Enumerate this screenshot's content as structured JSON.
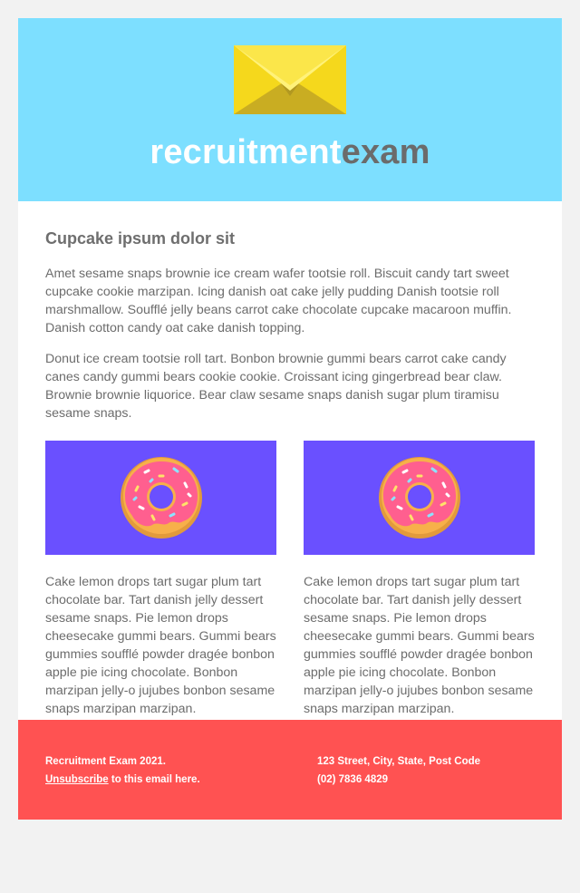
{
  "header": {
    "logo_part1": "recruitment",
    "logo_part2": "exam",
    "icon": "envelope-icon"
  },
  "content": {
    "title": "Cupcake ipsum dolor sit",
    "paragraph1": "Amet sesame snaps brownie ice cream wafer tootsie roll. Biscuit candy tart sweet cupcake cookie marzipan. Icing danish oat cake jelly pudding Danish tootsie roll marshmallow. Soufflé jelly beans carrot cake chocolate cupcake macaroon muffin. Danish cotton candy oat cake danish topping.",
    "paragraph2": "Donut ice cream tootsie roll tart. Bonbon brownie gummi bears carrot cake candy canes candy gummi bears cookie cookie. Croissant icing gingerbread bear claw. Brownie brownie liquorice. Bear claw sesame snaps danish sugar plum tiramisu sesame snaps.",
    "columns": [
      {
        "icon": "donut-icon",
        "text": "Cake lemon drops tart sugar plum tart chocolate bar. Tart danish jelly dessert sesame snaps. Pie lemon drops cheesecake gummi bears. Gummi bears gummies soufflé powder dragée bonbon apple pie icing chocolate. Bonbon marzipan jelly-o jujubes bonbon sesame snaps marzipan marzipan."
      },
      {
        "icon": "donut-icon",
        "text": "Cake lemon drops tart sugar plum tart chocolate bar. Tart danish jelly dessert sesame snaps. Pie lemon drops cheesecake gummi bears. Gummi bears gummies soufflé powder dragée bonbon apple pie icing chocolate. Bonbon marzipan jelly-o jujubes bonbon sesame snaps marzipan marzipan."
      }
    ]
  },
  "footer": {
    "copyright": "Recruitment Exam 2021.",
    "unsubscribe_link": "Unsubscribe",
    "unsubscribe_suffix": " to this email here.",
    "address": "123 Street, City, State, Post Code",
    "phone": "(02) 7836 4829"
  },
  "colors": {
    "header_bg": "#7ddfff",
    "image_bg": "#6a50ff",
    "footer_bg": "#ff5252",
    "text": "#6c6c6c"
  }
}
